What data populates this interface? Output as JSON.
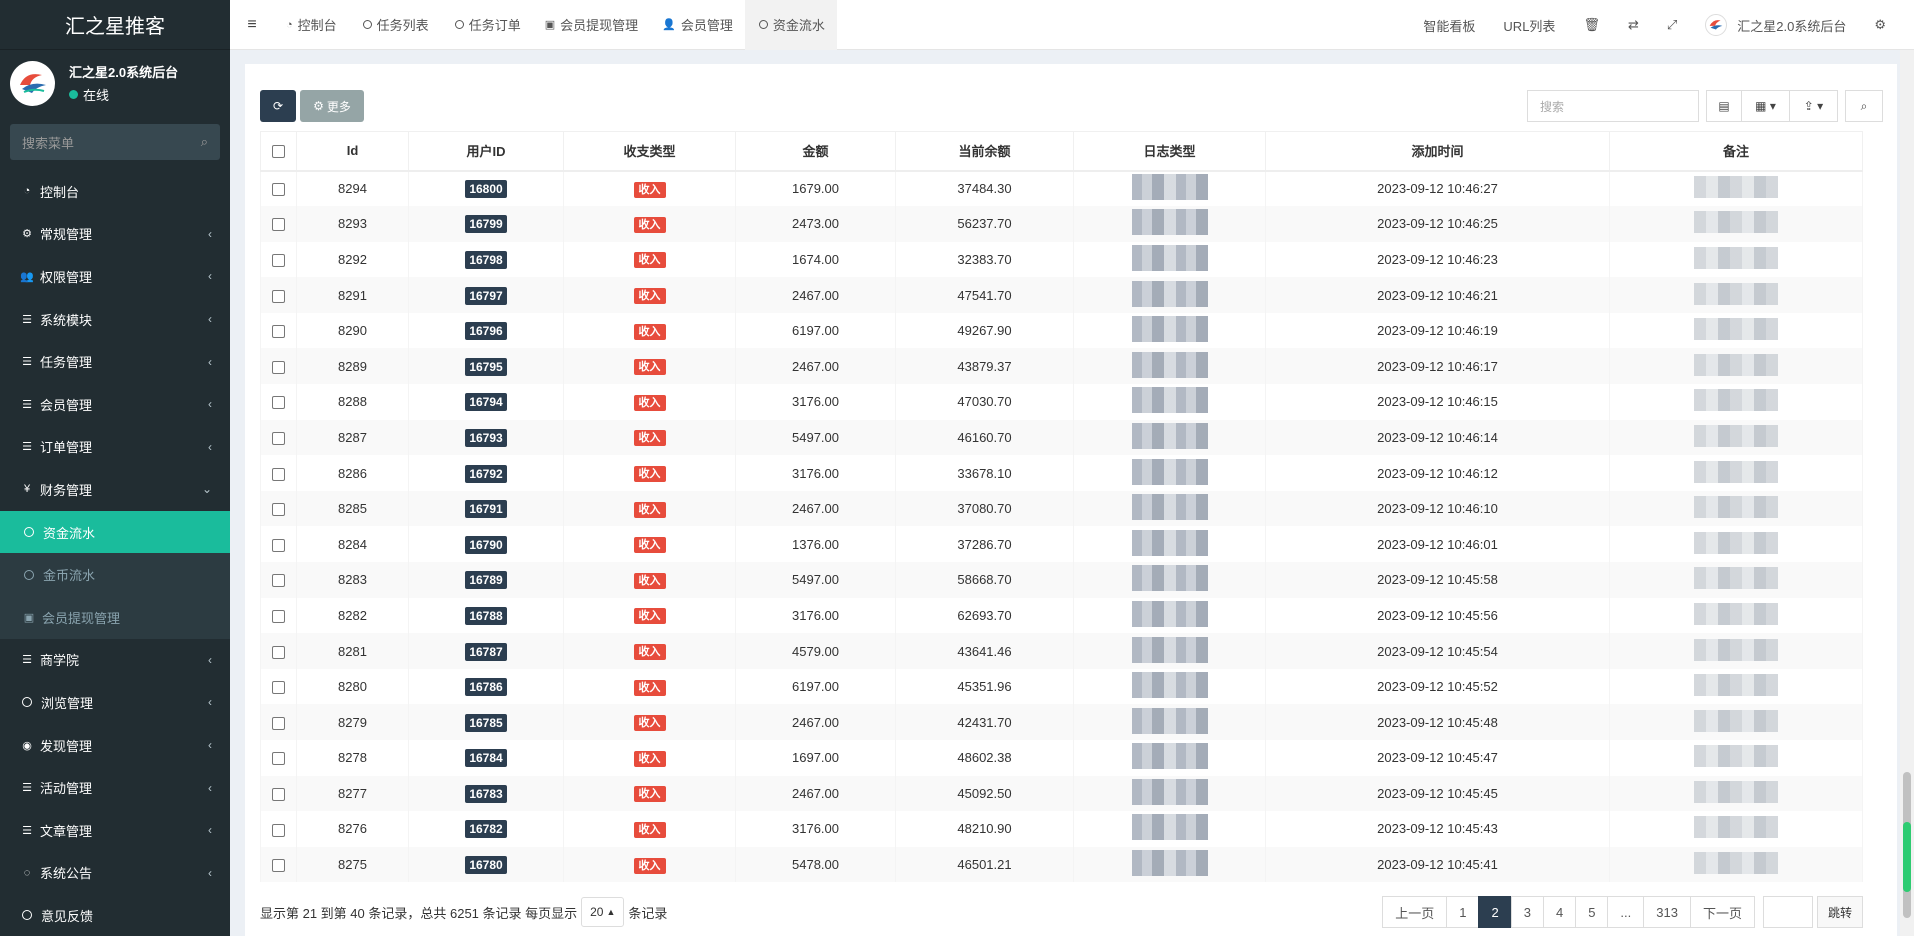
{
  "app": {
    "logo_text": "汇之星推客"
  },
  "user": {
    "name": "汇之星2.0系统后台",
    "status": "在线"
  },
  "sidebar": {
    "search_placeholder": "搜索菜单",
    "items": [
      {
        "label": "控制台",
        "icon": "dashboard-icon",
        "arrow": ""
      },
      {
        "label": "常规管理",
        "icon": "cogs-icon",
        "arrow": "‹"
      },
      {
        "label": "权限管理",
        "icon": "users-icon",
        "arrow": "‹"
      },
      {
        "label": "系统模块",
        "icon": "list-icon",
        "arrow": "‹"
      },
      {
        "label": "任务管理",
        "icon": "list-icon",
        "arrow": "‹"
      },
      {
        "label": "会员管理",
        "icon": "list-icon",
        "arrow": "‹"
      },
      {
        "label": "订单管理",
        "icon": "list-icon",
        "arrow": "‹"
      },
      {
        "label": "财务管理",
        "icon": "yen-icon",
        "arrow": "⌄"
      },
      {
        "label": "资金流水",
        "icon": "circle-icon",
        "arrow": "",
        "sub": true,
        "active": true
      },
      {
        "label": "金币流水",
        "icon": "circle-icon",
        "arrow": "",
        "sub": true
      },
      {
        "label": "会员提现管理",
        "icon": "money-icon",
        "arrow": "",
        "sub": true
      },
      {
        "label": "商学院",
        "icon": "list-icon",
        "arrow": "‹"
      },
      {
        "label": "浏览管理",
        "icon": "circle-icon",
        "arrow": "‹"
      },
      {
        "label": "发现管理",
        "icon": "globe-icon",
        "arrow": "‹"
      },
      {
        "label": "活动管理",
        "icon": "list-icon",
        "arrow": "‹"
      },
      {
        "label": "文章管理",
        "icon": "list-icon",
        "arrow": "‹"
      },
      {
        "label": "系统公告",
        "icon": "comment-icon",
        "arrow": "‹"
      },
      {
        "label": "意见反馈",
        "icon": "circle-icon",
        "arrow": ""
      }
    ]
  },
  "header": {
    "tabs": [
      {
        "label": "控制台",
        "icon": "dashboard-icon"
      },
      {
        "label": "任务列表",
        "icon": "circle-icon"
      },
      {
        "label": "任务订单",
        "icon": "circle-icon"
      },
      {
        "label": "会员提现管理",
        "icon": "money-icon"
      },
      {
        "label": "会员管理",
        "icon": "user-icon"
      },
      {
        "label": "资金流水",
        "icon": "circle-icon",
        "active": true
      }
    ],
    "right": {
      "dashboard_label": "智能看板",
      "url_list_label": "URL列表",
      "admin_name": "汇之星2.0系统后台"
    }
  },
  "toolbar": {
    "more_label": "更多",
    "search_placeholder": "搜索"
  },
  "table": {
    "columns": [
      "Id",
      "用户ID",
      "收支类型",
      "金额",
      "当前余额",
      "日志类型",
      "添加时间",
      "备注"
    ],
    "rows": [
      {
        "id": "8294",
        "uid": "16800",
        "type": "收入",
        "amount": "1679.00",
        "balance": "37484.30",
        "time": "2023-09-12 10:46:27"
      },
      {
        "id": "8293",
        "uid": "16799",
        "type": "收入",
        "amount": "2473.00",
        "balance": "56237.70",
        "time": "2023-09-12 10:46:25"
      },
      {
        "id": "8292",
        "uid": "16798",
        "type": "收入",
        "amount": "1674.00",
        "balance": "32383.70",
        "time": "2023-09-12 10:46:23"
      },
      {
        "id": "8291",
        "uid": "16797",
        "type": "收入",
        "amount": "2467.00",
        "balance": "47541.70",
        "time": "2023-09-12 10:46:21"
      },
      {
        "id": "8290",
        "uid": "16796",
        "type": "收入",
        "amount": "6197.00",
        "balance": "49267.90",
        "time": "2023-09-12 10:46:19"
      },
      {
        "id": "8289",
        "uid": "16795",
        "type": "收入",
        "amount": "2467.00",
        "balance": "43879.37",
        "time": "2023-09-12 10:46:17"
      },
      {
        "id": "8288",
        "uid": "16794",
        "type": "收入",
        "amount": "3176.00",
        "balance": "47030.70",
        "time": "2023-09-12 10:46:15"
      },
      {
        "id": "8287",
        "uid": "16793",
        "type": "收入",
        "amount": "5497.00",
        "balance": "46160.70",
        "time": "2023-09-12 10:46:14"
      },
      {
        "id": "8286",
        "uid": "16792",
        "type": "收入",
        "amount": "3176.00",
        "balance": "33678.10",
        "time": "2023-09-12 10:46:12"
      },
      {
        "id": "8285",
        "uid": "16791",
        "type": "收入",
        "amount": "2467.00",
        "balance": "37080.70",
        "time": "2023-09-12 10:46:10"
      },
      {
        "id": "8284",
        "uid": "16790",
        "type": "收入",
        "amount": "1376.00",
        "balance": "37286.70",
        "time": "2023-09-12 10:46:01"
      },
      {
        "id": "8283",
        "uid": "16789",
        "type": "收入",
        "amount": "5497.00",
        "balance": "58668.70",
        "time": "2023-09-12 10:45:58"
      },
      {
        "id": "8282",
        "uid": "16788",
        "type": "收入",
        "amount": "3176.00",
        "balance": "62693.70",
        "time": "2023-09-12 10:45:56"
      },
      {
        "id": "8281",
        "uid": "16787",
        "type": "收入",
        "amount": "4579.00",
        "balance": "43641.46",
        "time": "2023-09-12 10:45:54"
      },
      {
        "id": "8280",
        "uid": "16786",
        "type": "收入",
        "amount": "6197.00",
        "balance": "45351.96",
        "time": "2023-09-12 10:45:52"
      },
      {
        "id": "8279",
        "uid": "16785",
        "type": "收入",
        "amount": "2467.00",
        "balance": "42431.70",
        "time": "2023-09-12 10:45:48"
      },
      {
        "id": "8278",
        "uid": "16784",
        "type": "收入",
        "amount": "1697.00",
        "balance": "48602.38",
        "time": "2023-09-12 10:45:47"
      },
      {
        "id": "8277",
        "uid": "16783",
        "type": "收入",
        "amount": "2467.00",
        "balance": "45092.50",
        "time": "2023-09-12 10:45:45"
      },
      {
        "id": "8276",
        "uid": "16782",
        "type": "收入",
        "amount": "3176.00",
        "balance": "48210.90",
        "time": "2023-09-12 10:45:43"
      },
      {
        "id": "8275",
        "uid": "16780",
        "type": "收入",
        "amount": "5478.00",
        "balance": "46501.21",
        "time": "2023-09-12 10:45:41"
      }
    ]
  },
  "footer": {
    "summary_prefix": "显示第 21 到第 40 条记录，总共 6251 条记录 每页显示",
    "page_size": "20",
    "summary_suffix": "条记录",
    "pager": {
      "prev": "上一页",
      "pages": [
        "1",
        "2",
        "3",
        "4",
        "5",
        "...",
        "313"
      ],
      "active": "2",
      "next": "下一页",
      "jump": "跳转"
    }
  },
  "colors": {
    "sidebar_bg": "#222d32",
    "accent": "#1abc9c",
    "dark_btn": "#2c3e50",
    "income_badge": "#e74c3c"
  }
}
